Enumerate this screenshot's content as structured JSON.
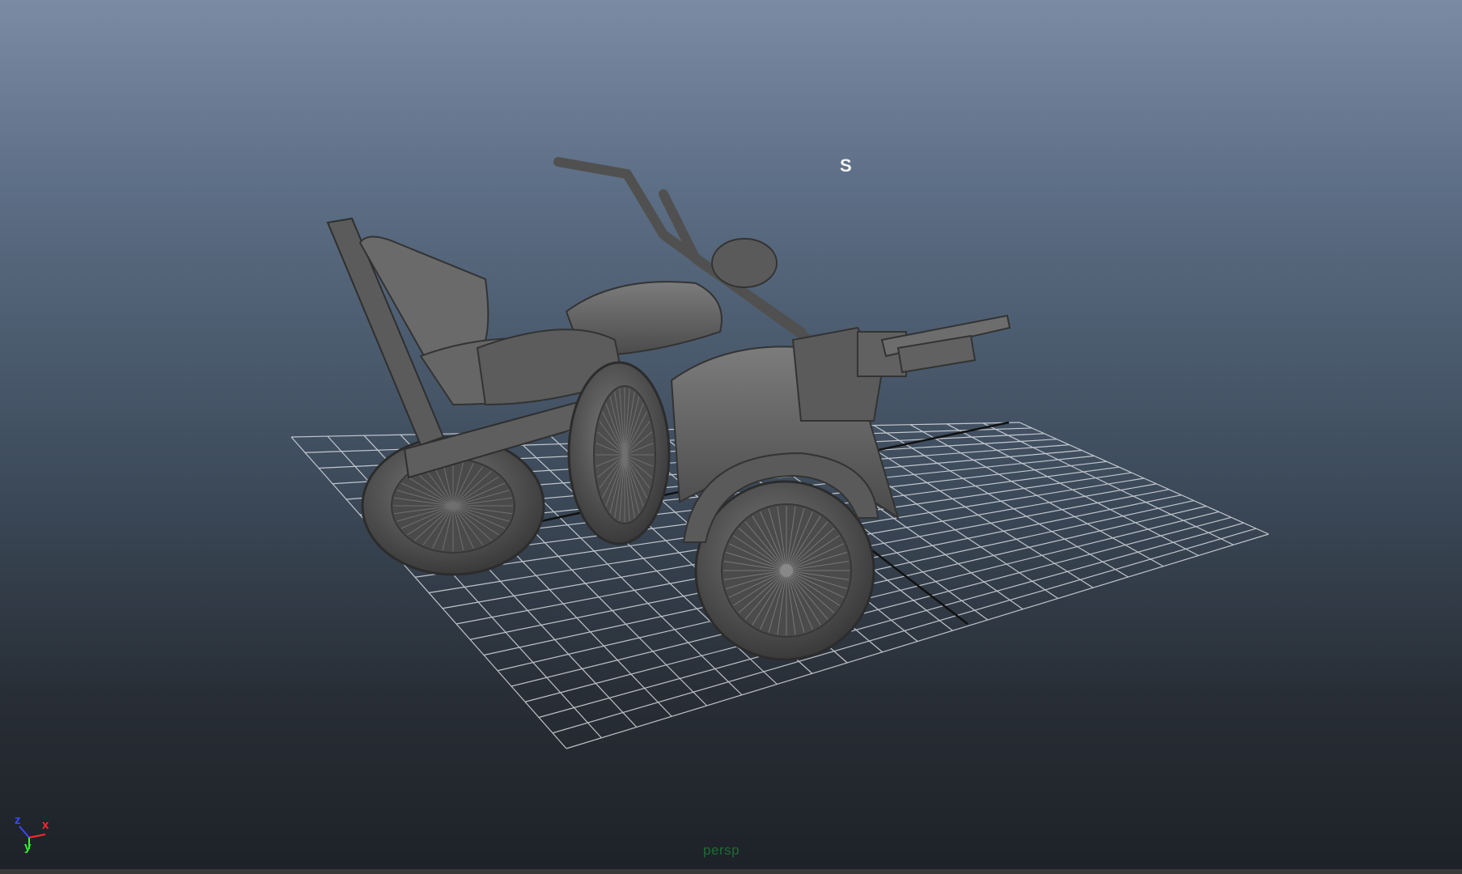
{
  "viewport": {
    "camera_label": "persp",
    "snap_marker": "S",
    "axes": {
      "x": "x",
      "y": "y",
      "z": "z"
    },
    "colors": {
      "background_top": "#7a8ba3",
      "background_bottom": "#1e2228",
      "grid": "#d9dde3",
      "model": "#626262",
      "camera_label": "#1f6a36"
    },
    "icons": [
      "view-axis-gizmo-icon"
    ]
  }
}
